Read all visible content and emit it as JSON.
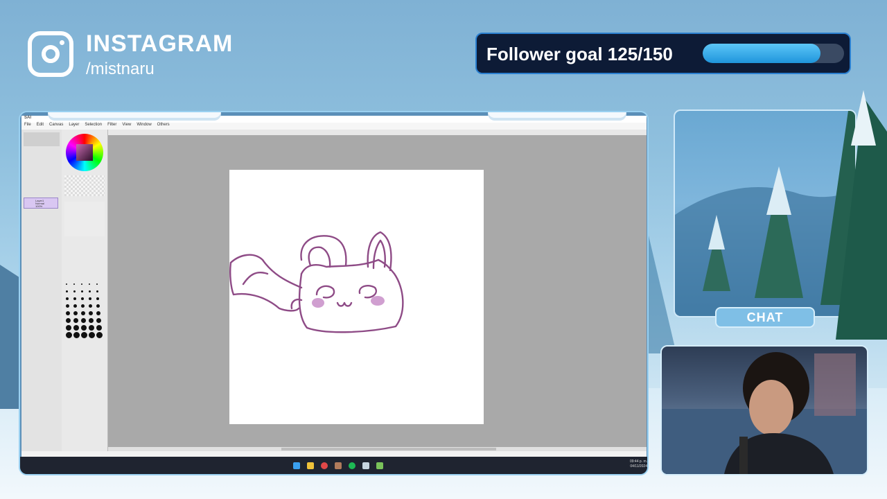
{
  "instagram": {
    "title": "INSTAGRAM",
    "handle": "/mistnaru"
  },
  "follower_goal": {
    "label": "Follower goal 125/150",
    "current": 125,
    "target": 150,
    "progress_fraction": 0.833
  },
  "app": {
    "name": "SAI",
    "menu": [
      "File",
      "Edit",
      "Canvas",
      "Layer",
      "Selection",
      "Filter",
      "View",
      "Window",
      "Others"
    ],
    "layer_name": "Layer1",
    "layer_mode": "Normal",
    "layer_opacity": "100%"
  },
  "chat": {
    "label": "CHAT"
  },
  "colors": {
    "goal_fill": "#1f95dc",
    "goal_bg": "#0d1b36",
    "sketch_stroke": "#8e4b86",
    "blush": "#c88ec8"
  },
  "taskbar": {
    "time": "09:44 p. m.",
    "date": "04/11/2024"
  },
  "icons": [
    "instagram-icon",
    "windows-start-icon",
    "file-explorer-icon",
    "spotify-icon",
    "steam-icon"
  ]
}
